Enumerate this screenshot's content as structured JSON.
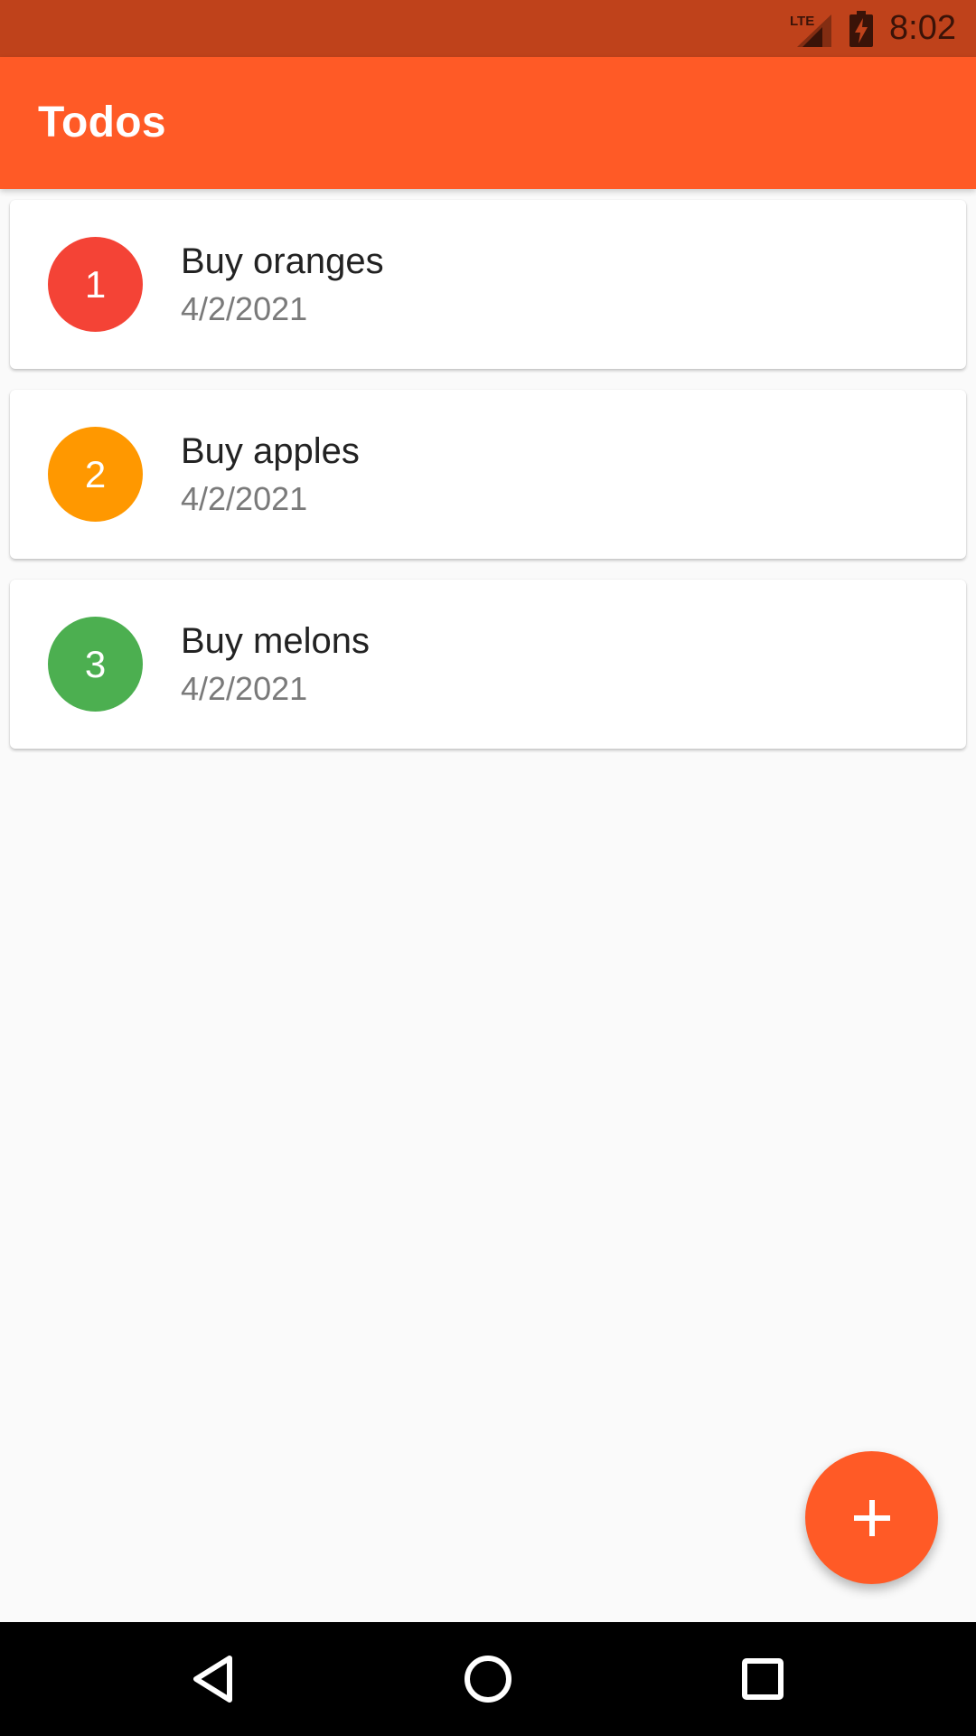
{
  "status_bar": {
    "network": "LTE",
    "time": "8:02"
  },
  "app_bar": {
    "title": "Todos"
  },
  "todos": [
    {
      "number": "1",
      "title": "Buy oranges",
      "date": "4/2/2021",
      "color": "#f44336"
    },
    {
      "number": "2",
      "title": "Buy apples",
      "date": "4/2/2021",
      "color": "#ff9800"
    },
    {
      "number": "3",
      "title": "Buy melons",
      "date": "4/2/2021",
      "color": "#4caf50"
    }
  ],
  "fab": {
    "icon": "plus-icon",
    "color": "#ff5a26"
  },
  "nav_bar": {
    "back_icon": "back-triangle-icon",
    "home_icon": "home-circle-icon",
    "recents_icon": "recents-square-icon"
  },
  "colors": {
    "status_bar": "#bf421b",
    "app_bar": "#ff5a26",
    "background": "#fafafa"
  }
}
